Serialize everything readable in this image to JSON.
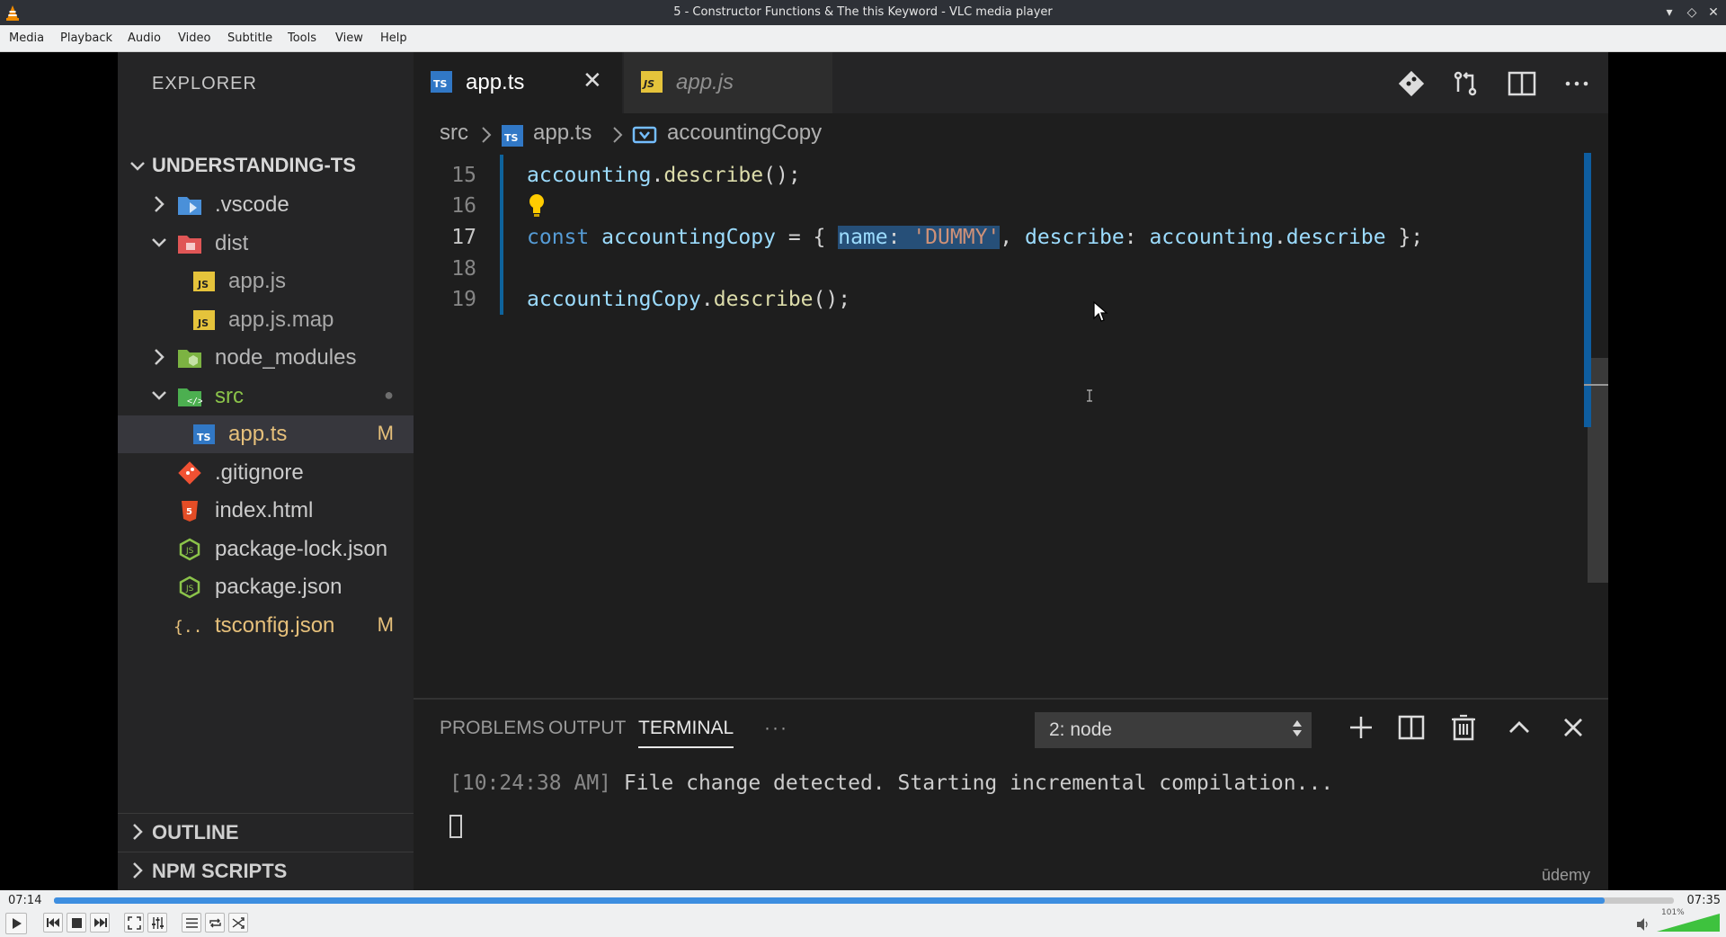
{
  "window": {
    "title": "5 - Constructor Functions & The this Keyword - VLC media player",
    "controls": [
      "▾",
      "◇",
      "✕"
    ]
  },
  "menubar": [
    "Media",
    "Playback",
    "Audio",
    "Video",
    "Subtitle",
    "Tools",
    "View",
    "Help"
  ],
  "vscode": {
    "explorer_title": "EXPLORER",
    "project": "UNDERSTANDING-TS",
    "tree": [
      {
        "label": ".vscode",
        "icon": "vscode-folder-icon",
        "type": "folder"
      },
      {
        "label": "dist",
        "icon": "dist-folder-icon",
        "type": "folder-open"
      },
      {
        "label": "app.js",
        "icon": "js-file-icon",
        "type": "file"
      },
      {
        "label": "app.js.map",
        "icon": "js-map-file-icon",
        "type": "file"
      },
      {
        "label": "node_modules",
        "icon": "node-folder-icon",
        "type": "folder"
      },
      {
        "label": "src",
        "icon": "src-folder-icon",
        "type": "folder-open",
        "badge": "●"
      },
      {
        "label": "app.ts",
        "icon": "ts-file-icon",
        "type": "file",
        "badge": "M"
      },
      {
        "label": ".gitignore",
        "icon": "git-file-icon",
        "type": "file"
      },
      {
        "label": "index.html",
        "icon": "html-file-icon",
        "type": "file"
      },
      {
        "label": "package-lock.json",
        "icon": "npm-json-icon",
        "type": "file"
      },
      {
        "label": "package.json",
        "icon": "npm-json-icon",
        "type": "file"
      },
      {
        "label": "tsconfig.json",
        "icon": "json-file-icon",
        "type": "file",
        "badge": "M"
      }
    ],
    "sections": [
      "OUTLINE",
      "NPM SCRIPTS"
    ],
    "tabs": [
      {
        "label": "app.ts",
        "icon_text": "TS",
        "active": true,
        "close": "✕"
      },
      {
        "label": "app.js",
        "icon_text": "JS",
        "active": false
      }
    ],
    "ts_badge": "TS",
    "js_badge": "JS",
    "breadcrumb": {
      "part1": "src",
      "part2": "app.ts",
      "part3": "accountingCopy"
    },
    "code": {
      "line_numbers": [
        "15",
        "16",
        "17",
        "18",
        "19"
      ],
      "line15": {
        "a": "accounting",
        "b": ".",
        "c": "describe",
        "d": "();"
      },
      "line17": {
        "kw": "const",
        "var": "accountingCopy",
        "eq": " = { ",
        "sel_key": "name",
        "sel_colon": ": ",
        "sel_str": "'DUMMY'",
        "comma": ", ",
        "key2": "describe",
        "colon2": ": ",
        "obj": "accounting",
        "dot": ".",
        "prop": "describe",
        "end": " };"
      },
      "line19": {
        "a": "accountingCopy",
        "b": ".",
        "c": "describe",
        "d": "();"
      }
    },
    "panel": {
      "tabs": [
        "PROBLEMS",
        "OUTPUT",
        "TERMINAL",
        "···"
      ],
      "terminal_select": "2: node",
      "terminal_time": "[10:24:38 AM]",
      "terminal_msg": " File change detected. Starting incremental compilation..."
    },
    "watermark": "ūdemy"
  },
  "player": {
    "elapsed": "07:14",
    "total": "07:35",
    "progress": 0.957,
    "volume_label": "101%",
    "volume": 1.01
  },
  "colors": {
    "accent": "#3d8ee0",
    "selection": "#264f78",
    "ts_blue": "#3178c6",
    "js_yellow": "#e5c33b"
  }
}
